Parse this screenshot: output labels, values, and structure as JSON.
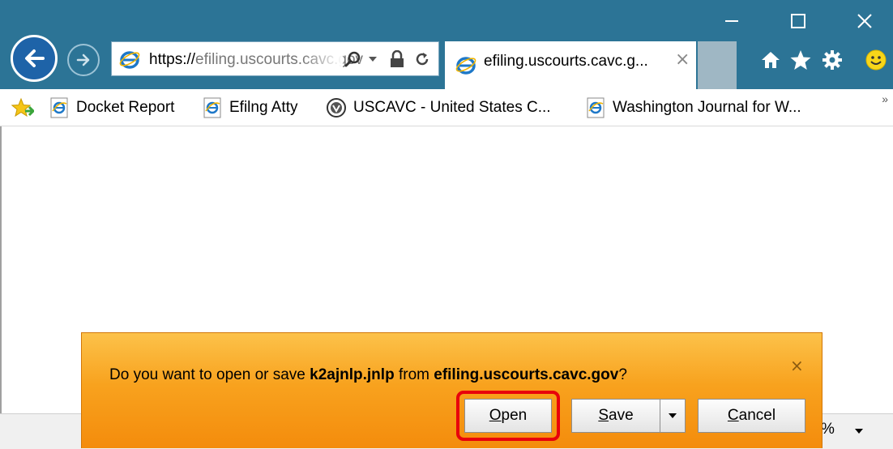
{
  "window": {
    "minimize_icon": "minimize-icon",
    "maximize_icon": "maximize-icon",
    "close_icon": "close-icon"
  },
  "address_bar": {
    "url_protocol": "https://",
    "url_rest": "efiling.uscourts.cavc.gov"
  },
  "tab": {
    "title": "efiling.uscourts.cavc.g...",
    "close": "×"
  },
  "toolbar": {
    "icons": [
      "home-icon",
      "favorites-star-icon",
      "gear-icon",
      "smiley-feedback-icon"
    ]
  },
  "favorites_bar": {
    "items": [
      {
        "label": "Docket Report",
        "icon": "ie-page-icon"
      },
      {
        "label": "Efilng Atty",
        "icon": "ie-page-icon"
      },
      {
        "label": "USCAVC - United States C...",
        "icon": "court-seal-icon"
      },
      {
        "label": "Washington Journal for W...",
        "icon": "ie-page-icon"
      }
    ],
    "more": "»"
  },
  "status_bar": {
    "zoom_fragment": "%"
  },
  "notification": {
    "prefix": "Do you want to open or save ",
    "filename": "k2ajnlp.jnlp",
    "middle": " from ",
    "domain": "efiling.uscourts.cavc.gov",
    "suffix": "?",
    "close": "×",
    "open_mnemonic": "O",
    "open_rest": "pen",
    "save_mnemonic": "S",
    "save_rest": "ave",
    "cancel_mnemonic": "C",
    "cancel_rest": "ancel"
  },
  "colors": {
    "titlebar": "#2c7496",
    "notification": "#f8a21e",
    "highlight": "#e8000b"
  }
}
